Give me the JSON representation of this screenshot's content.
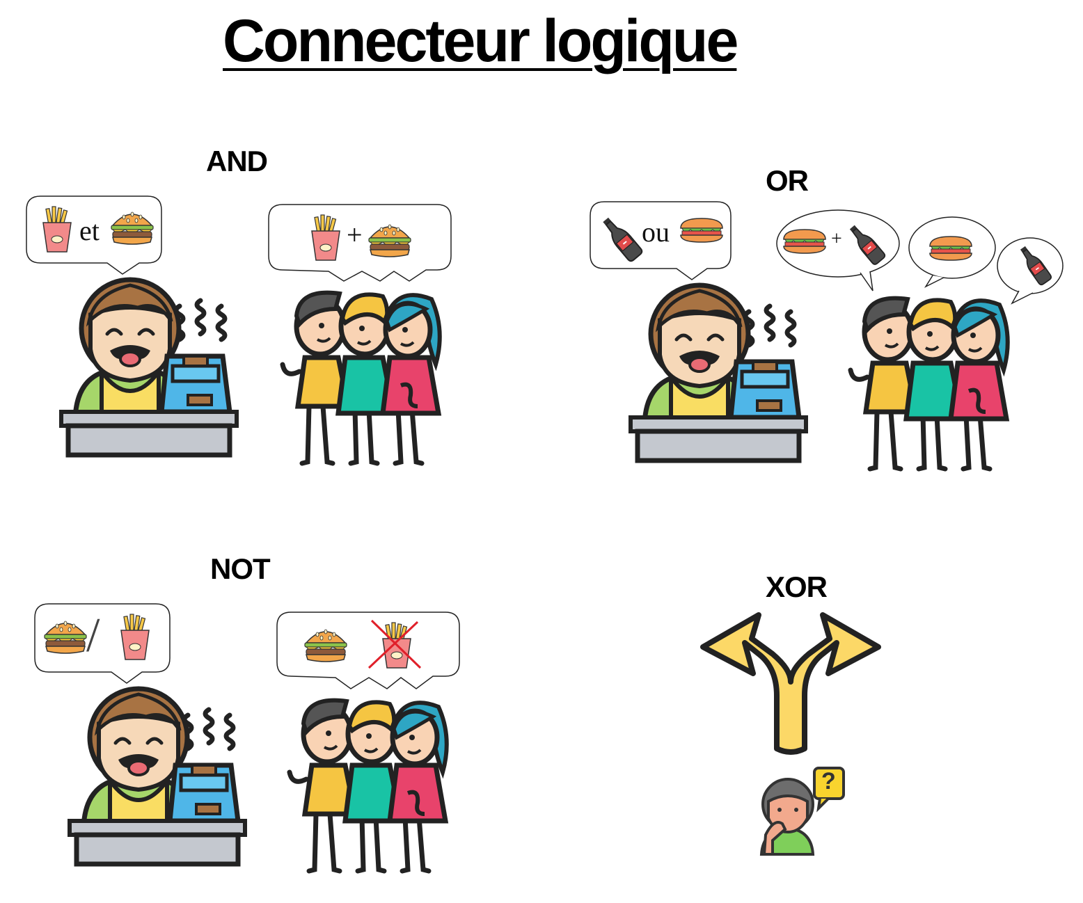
{
  "title": "Connecteur logique",
  "sections": {
    "and": {
      "label": "AND",
      "cashier_word": "et",
      "crowd_word": "+"
    },
    "or": {
      "label": "OR",
      "cashier_word": "ou",
      "crowd_word": "+"
    },
    "not": {
      "label": "NOT",
      "cashier_word": "/"
    },
    "xor": {
      "label": "XOR",
      "question_mark": "?"
    }
  },
  "icons": {
    "fries": "fries-icon",
    "burger": "burger-icon",
    "cola": "cola-bottle-icon",
    "sandwich": "sandwich-icon",
    "cashier": "cashier-icon",
    "crowd": "customers-icon",
    "fork_arrow": "fork-arrow-icon",
    "thinking_person": "thinking-person-icon"
  },
  "colors": {
    "yellow_shirt": "#f5c542",
    "green_shirt": "#19c3a5",
    "pink_shirt": "#e8436b",
    "cross_red": "#e0202a",
    "arrow_yellow": "#fcd867"
  }
}
